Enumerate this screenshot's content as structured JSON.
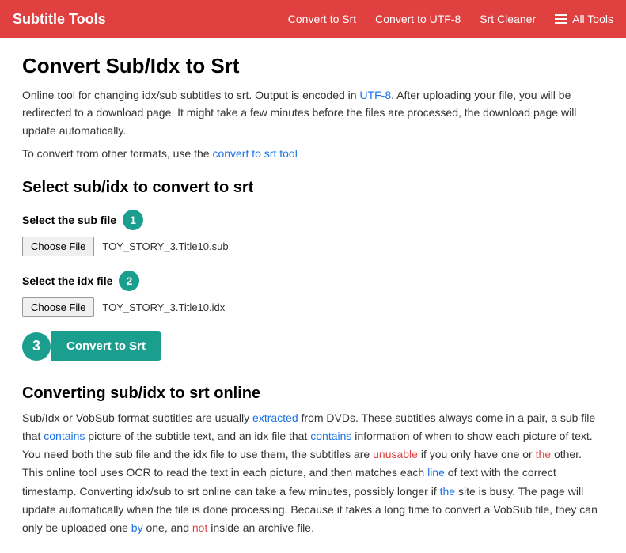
{
  "nav": {
    "brand": "Subtitle Tools",
    "links": [
      {
        "label": "Convert to Srt"
      },
      {
        "label": "Convert to UTF-8"
      },
      {
        "label": "Srt Cleaner"
      }
    ],
    "all_tools_label": "All Tools"
  },
  "page": {
    "title": "Convert Sub/Idx to Srt",
    "intro": {
      "part1": "Online tool for changing idx/sub subtitles to srt. Output is encoded in ",
      "utf8_link": "UTF-8",
      "part2": ". After uploading your file, you will be redirected to a download page. It might take a few minutes before the files are processed, the download page will update automatically."
    },
    "convert_other": {
      "text": "To convert from other formats, use the ",
      "link": "convert to srt tool"
    },
    "section_title": "Select sub/idx to convert to srt",
    "sub_label": "Select the sub file",
    "sub_step": "1",
    "sub_choose_btn": "Choose File",
    "sub_filename": "TOY_STORY_3.Title10.sub",
    "idx_label": "Select the idx file",
    "idx_step": "2",
    "idx_choose_btn": "Choose File",
    "idx_filename": "TOY_STORY_3.Title10.idx",
    "convert_step": "3",
    "convert_btn_label": "Convert to Srt",
    "article_title": "Converting sub/idx to srt online",
    "article_text": "Sub/Idx or VobSub format subtitles are usually extracted from DVDs. These subtitles always come in a pair, a sub file that contains picture of the subtitle text, and an idx file that contains information of when to show each picture of text. You need both the sub file and the idx file to use them, the subtitles are unusable if you only have one or the other. This online tool uses OCR to read the text in each picture, and then matches each line of text with the correct timestamp. Converting idx/sub to srt online can take a few minutes, possibly longer if the site is busy. The page will update automatically when the file is done processing. Because it takes a long time to convert a VobSub file, they can only be uploaded one by one, and not inside an archive file."
  }
}
